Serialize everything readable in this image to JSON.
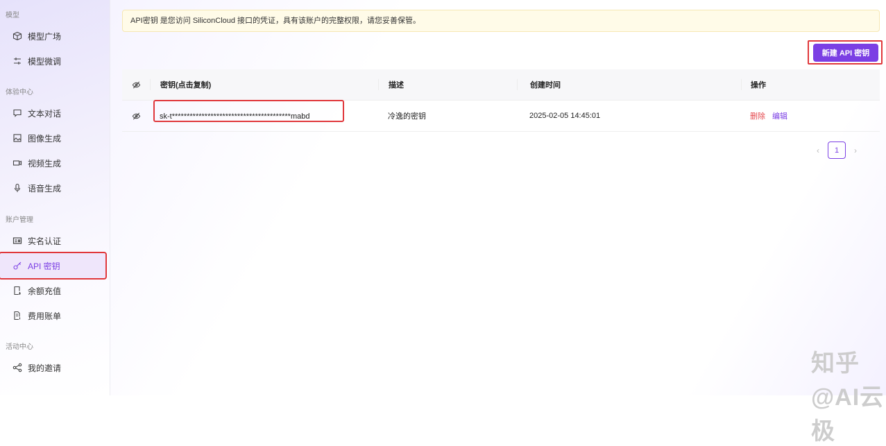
{
  "sidebar": {
    "sections": [
      "模型",
      "体验中心",
      "账户管理",
      "活动中心"
    ],
    "items": [
      {
        "label": "模型广场",
        "icon": "cube-icon"
      },
      {
        "label": "模型微调",
        "icon": "sliders-icon"
      },
      {
        "label": "文本对话",
        "icon": "chat-icon"
      },
      {
        "label": "图像生成",
        "icon": "image-icon"
      },
      {
        "label": "视频生成",
        "icon": "video-icon"
      },
      {
        "label": "语音生成",
        "icon": "microphone-icon"
      },
      {
        "label": "实名认证",
        "icon": "id-card-icon"
      },
      {
        "label": "API 密钥",
        "icon": "key-icon",
        "active": true
      },
      {
        "label": "余额充值",
        "icon": "recharge-icon"
      },
      {
        "label": "费用账单",
        "icon": "bill-icon"
      },
      {
        "label": "我的邀请",
        "icon": "share-icon"
      }
    ]
  },
  "banner": "API密钥 是您访问 SiliconCloud 接口的凭证，具有该账户的完整权限，请您妥善保管。",
  "new_button": "新建 API 密钥",
  "table": {
    "headers": [
      "密钥(点击复制)",
      "描述",
      "创建时间",
      "操作"
    ],
    "rows": [
      {
        "key": "sk-t****************************************mabd",
        "desc": "冷逸的密钥",
        "created": "2025-02-05 14:45:01",
        "delete": "删除",
        "edit": "编辑"
      }
    ]
  },
  "pagination": {
    "current": "1"
  },
  "watermark": "知乎 @AI云极",
  "colors": {
    "accent": "#7b3fe4",
    "danger": "#e5484d",
    "highlight": "#e0373b"
  }
}
